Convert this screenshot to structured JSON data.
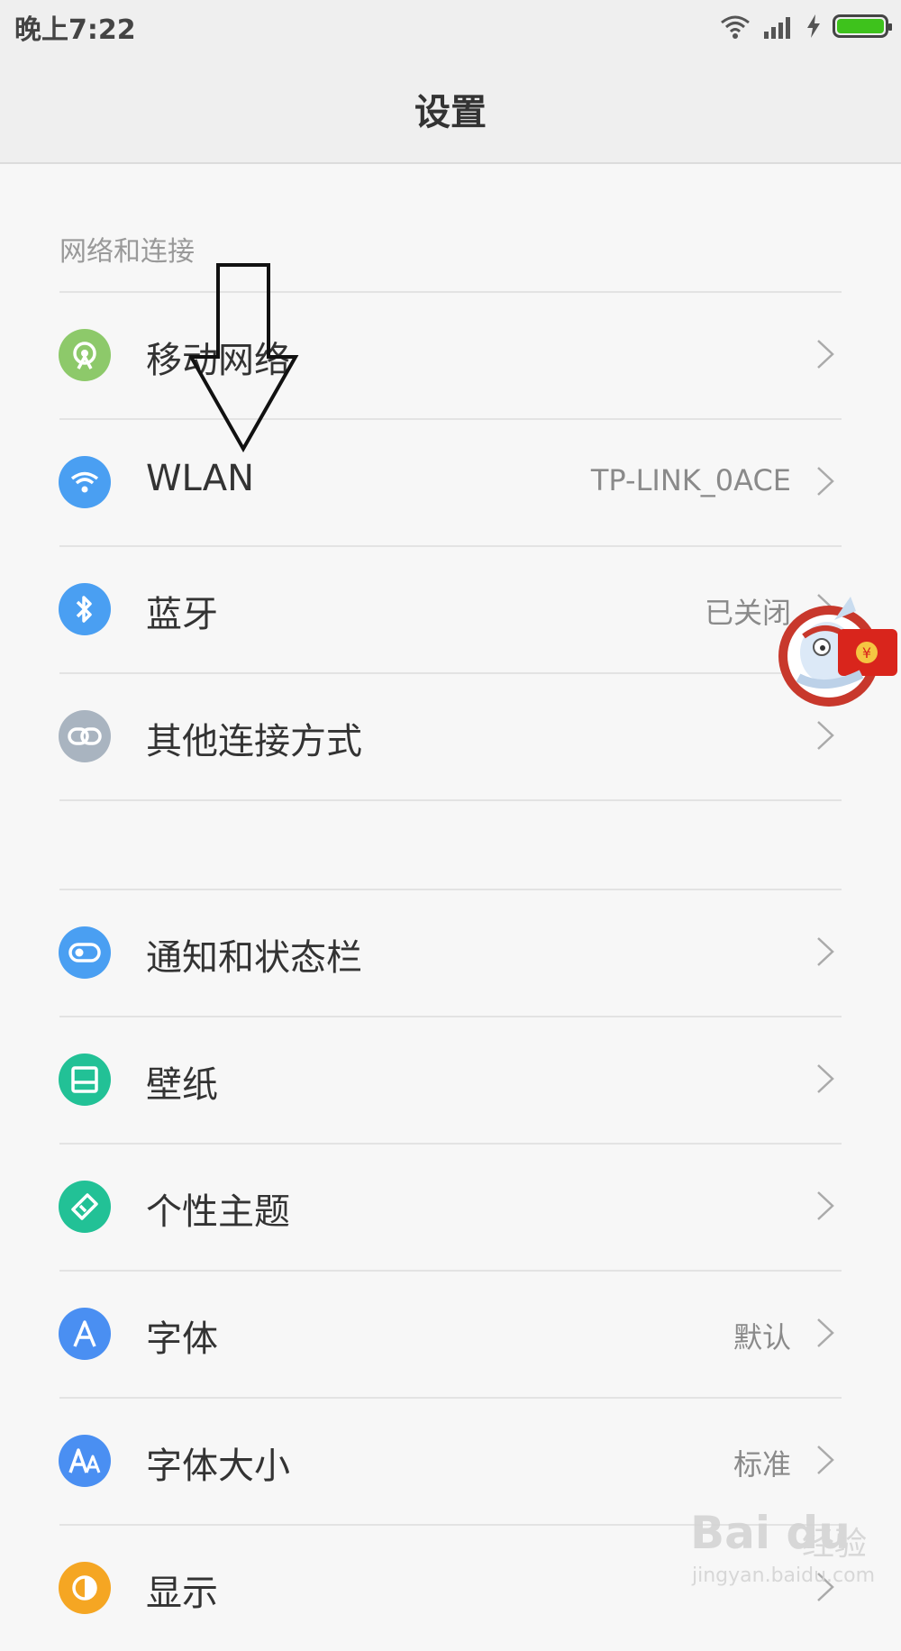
{
  "status_bar": {
    "time": "晚上7:22",
    "icons": [
      "wifi-icon",
      "signal-icon",
      "charging-icon",
      "battery-icon"
    ],
    "battery_color": "#3ec21c"
  },
  "header": {
    "title": "设置"
  },
  "sections": [
    {
      "header": "网络和连接",
      "items": [
        {
          "label": "移动网络",
          "value": "",
          "icon": "mobile-network-icon",
          "icon_color": "#8dc96a"
        },
        {
          "label": "WLAN",
          "value": "TP-LINK_0ACE",
          "icon": "wifi-icon",
          "icon_color": "#4a9ff2"
        },
        {
          "label": "蓝牙",
          "value": "已关闭",
          "icon": "bluetooth-icon",
          "icon_color": "#4a9ff2"
        },
        {
          "label": "其他连接方式",
          "value": "",
          "icon": "link-icon",
          "icon_color": "#a9b4c0"
        }
      ]
    },
    {
      "header": "",
      "items": [
        {
          "label": "通知和状态栏",
          "value": "",
          "icon": "notification-toggle-icon",
          "icon_color": "#4a9ff2"
        },
        {
          "label": "壁纸",
          "value": "",
          "icon": "wallpaper-icon",
          "icon_color": "#22c196"
        },
        {
          "label": "个性主题",
          "value": "",
          "icon": "theme-brush-icon",
          "icon_color": "#22c196"
        },
        {
          "label": "字体",
          "value": "默认",
          "icon": "font-icon",
          "icon_color": "#4a8ff2"
        },
        {
          "label": "字体大小",
          "value": "标准",
          "icon": "font-size-icon",
          "icon_color": "#4a8ff2"
        },
        {
          "label": "显示",
          "value": "",
          "icon": "display-icon",
          "icon_color": "#f5a623"
        }
      ]
    }
  ],
  "watermark": {
    "brand": "Bai du",
    "jingyan": "经验",
    "url": "jingyan.baidu.com"
  }
}
